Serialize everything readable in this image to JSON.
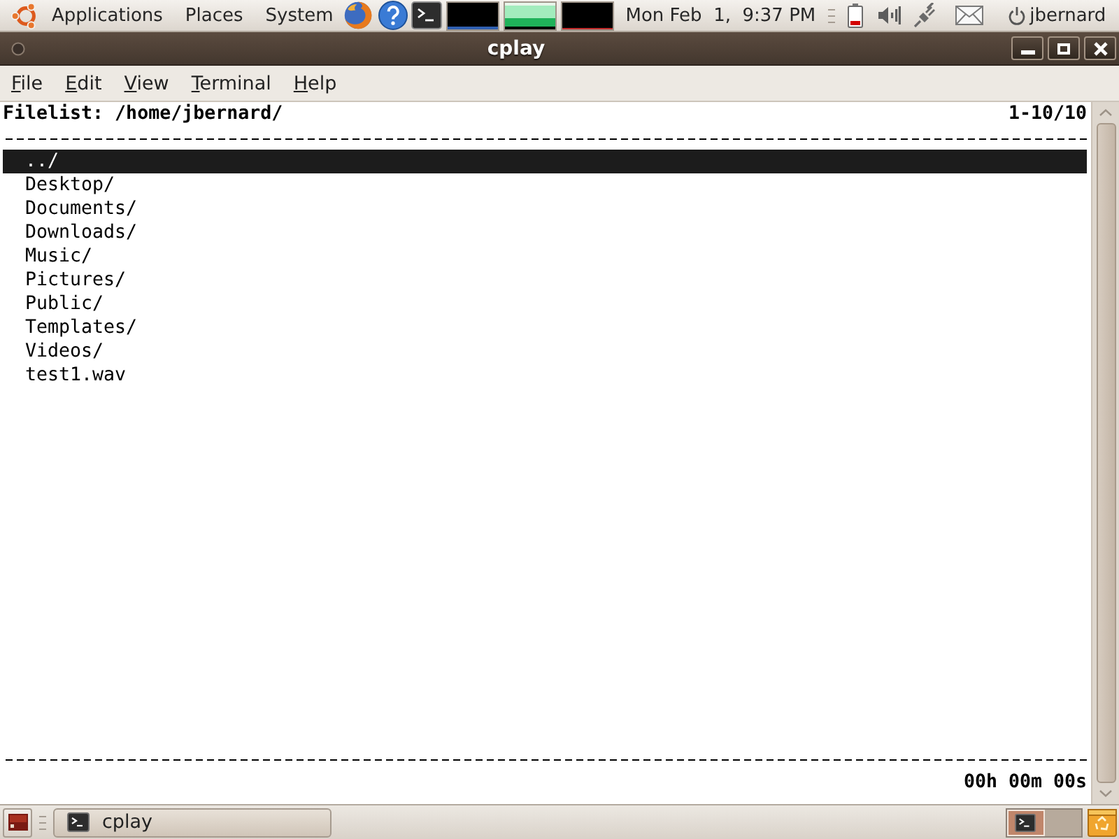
{
  "top_panel": {
    "menus": [
      "Applications",
      "Places",
      "System"
    ],
    "clock": "Mon Feb  1,  9:37 PM",
    "user": "jbernard"
  },
  "window": {
    "title": "cplay"
  },
  "menu_bar": [
    "File",
    "Edit",
    "View",
    "Terminal",
    "Help"
  ],
  "terminal": {
    "header": "Filelist: /home/jbernard/",
    "position": "1-10/10",
    "files": [
      {
        "name": "../",
        "selected": true
      },
      {
        "name": "Desktop/",
        "selected": false
      },
      {
        "name": "Documents/",
        "selected": false
      },
      {
        "name": "Downloads/",
        "selected": false
      },
      {
        "name": "Music/",
        "selected": false
      },
      {
        "name": "Pictures/",
        "selected": false
      },
      {
        "name": "Public/",
        "selected": false
      },
      {
        "name": "Templates/",
        "selected": false
      },
      {
        "name": "Videos/",
        "selected": false
      },
      {
        "name": "test1.wav",
        "selected": false
      }
    ],
    "timer": "00h 00m 00s"
  },
  "taskbar": {
    "tasks": [
      "cplay"
    ],
    "workspaces": [
      {
        "selected": true
      },
      {
        "selected": false
      }
    ]
  }
}
